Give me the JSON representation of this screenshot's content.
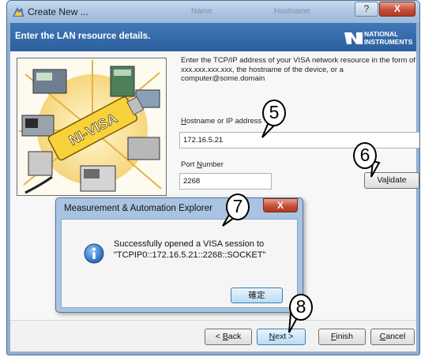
{
  "window": {
    "title": "Create New ...",
    "ghost_name": "Name",
    "ghost_hostname": "Hostname",
    "help_label": "?",
    "close_label": "X"
  },
  "header": {
    "text": "Enter the LAN resource details.",
    "logo_line1": "NATIONAL",
    "logo_line2": "INSTRUMENTS"
  },
  "illustration": {
    "label": "NI-VISA"
  },
  "form": {
    "description": "Enter the TCP/IP address of your VISA network resource in the form of xxx.xxx.xxx.xxx, the hostname of the device, or a computer@some.domain",
    "hostname_label_pre": "",
    "hostname_label_u": "H",
    "hostname_label_post": "ostname or IP address",
    "hostname_value": "172.16.5.21",
    "port_label_pre": "Port ",
    "port_label_u": "N",
    "port_label_post": "umber",
    "port_value": "2268",
    "validate_pre": "Va",
    "validate_u": "l",
    "validate_post": "idate"
  },
  "footer": {
    "back_pre": "< ",
    "back_u": "B",
    "back_post": "ack",
    "next_u": "N",
    "next_post": "ext >",
    "finish_u": "F",
    "finish_post": "inish",
    "cancel_u": "C",
    "cancel_post": "ancel"
  },
  "dialog": {
    "title": "Measurement & Automation Explorer",
    "close_label": "X",
    "message_line1": "Successfully opened a VISA session to",
    "message_line2": "\"TCPIP0::172.16.5.21::2268::SOCKET\"",
    "ok_label": "確定"
  },
  "callouts": {
    "c5": "5",
    "c6": "6",
    "c7": "7",
    "c8": "8"
  },
  "colors": {
    "header_blue": "#2d5f9c",
    "window_frame": "#8fb0d2",
    "dialog_frame": "#a9c4e2",
    "close_red": "#c24a33",
    "info_blue": "#2f6fc4"
  }
}
